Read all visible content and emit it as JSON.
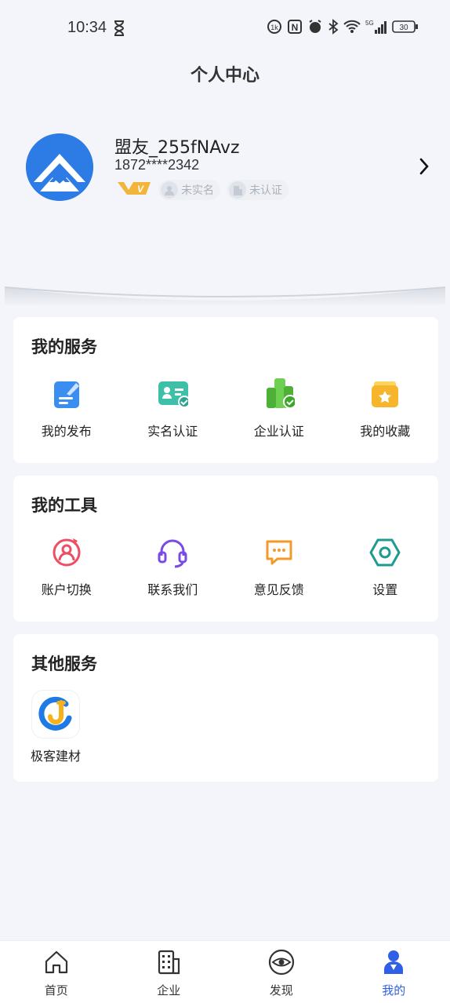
{
  "status_bar": {
    "time": "10:34",
    "battery": "30",
    "network": "5G"
  },
  "header": {
    "title": "个人中心"
  },
  "profile": {
    "username": "盟友_255fNAvz",
    "phone": "1872****2342",
    "vip_label": "V",
    "badges": [
      "未实名",
      "未认证"
    ]
  },
  "sections": {
    "services": {
      "title": "我的服务",
      "items": [
        "我的发布",
        "实名认证",
        "企业认证",
        "我的收藏"
      ]
    },
    "tools": {
      "title": "我的工具",
      "items": [
        "账户切换",
        "联系我们",
        "意见反馈",
        "设置"
      ]
    },
    "other": {
      "title": "其他服务",
      "items": [
        "极客建材"
      ]
    }
  },
  "bottom_nav": {
    "items": [
      "首页",
      "企业",
      "发现",
      "我的"
    ],
    "active": "我的"
  },
  "colors": {
    "accent": "#2e5fe6",
    "avatar": "#2d7be5",
    "background": "#f3f5fa"
  }
}
